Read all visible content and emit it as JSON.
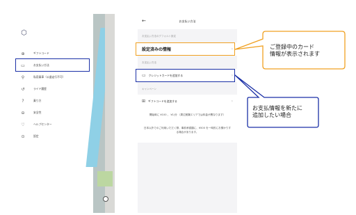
{
  "side_menu": {
    "logo": "⬡",
    "items": [
      {
        "icon": "ticket-icon",
        "glyph": "⊕",
        "label": "ギフトコード"
      },
      {
        "icon": "card-icon",
        "glyph": "▭",
        "label": "お支払い方法"
      },
      {
        "icon": "scooter-icon",
        "glyph": "⚲",
        "label": "私用乗車（公道走行不可）"
      },
      {
        "icon": "history-icon",
        "glyph": "↺",
        "label": "ライド履歴"
      },
      {
        "icon": "help-icon",
        "glyph": "?",
        "label": "乗り方"
      },
      {
        "icon": "safety-icon",
        "glyph": "⊖",
        "label": "安全性"
      },
      {
        "icon": "heart-icon",
        "glyph": "♡",
        "label": "ヘルプセンター"
      },
      {
        "icon": "settings-icon",
        "glyph": "⊙",
        "label": "設定"
      }
    ]
  },
  "payment_screen": {
    "back": "←",
    "title": "お支払い方法",
    "default_section_label": "お支払い方法のデフォルト設定",
    "registered_info": "設定済みの情報",
    "methods_section_label": "お支払い方法",
    "add_card_label": "クレジットカードを追加する",
    "campaign_section_label": "キャンペーン",
    "add_gift_code_label": "ギフトコードを追加する",
    "note_1": "開始時に ¥100 、 ¥1/分 （周辺実験エリアでは料金が異なります）",
    "note_2": "日本以外でのご利用いただく際、事前承認額に、¥500 を一時的にお預かりする場合があります。"
  },
  "callouts": {
    "registered_card_line1": "ご登録中のカード",
    "registered_card_line2": "情報が表示されます",
    "add_new_line1": "お支払情報を新たに",
    "add_new_line2": "追加したい場合"
  },
  "colors": {
    "highlight_blue": "#1a2fa6",
    "highlight_orange": "#f0a020"
  }
}
